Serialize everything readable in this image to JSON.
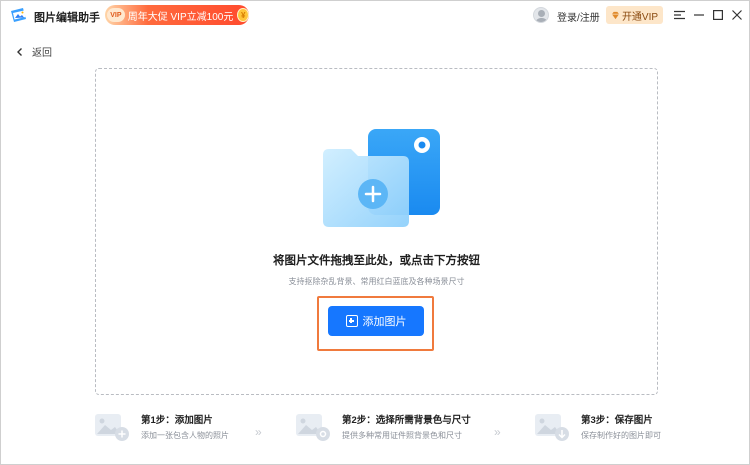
{
  "titlebar": {
    "app_title": "图片编辑助手",
    "promo": {
      "vip_tag": "VIP",
      "text": "周年大促 VIP立减100元",
      "coin_label": "¥"
    },
    "login_label": "登录/注册",
    "vip_button_label": "开通VIP",
    "window_controls": [
      "menu-icon",
      "minimize-icon",
      "maximize-icon",
      "close-icon"
    ]
  },
  "nav": {
    "back_label": "返回"
  },
  "dropzone": {
    "title": "将图片文件拖拽至此处，或点击下方按钮",
    "subtitle": "支持抠除杂乱背景、常用红白蓝底及各种场景尺寸",
    "add_button_label": "添加图片"
  },
  "steps": [
    {
      "title": "第1步：添加图片",
      "desc": "添加一张包含人物的照片"
    },
    {
      "title": "第2步：选择所需背景色与尺寸",
      "desc": "提供多种常用证件照背景色和尺寸"
    },
    {
      "title": "第3步：保存图片",
      "desc": "保存制作好的图片即可"
    }
  ],
  "colors": {
    "accent": "#1677ff",
    "highlight": "#f07a3d",
    "promo": "#ff4a2e",
    "vip_bg": "#fde6c9"
  }
}
